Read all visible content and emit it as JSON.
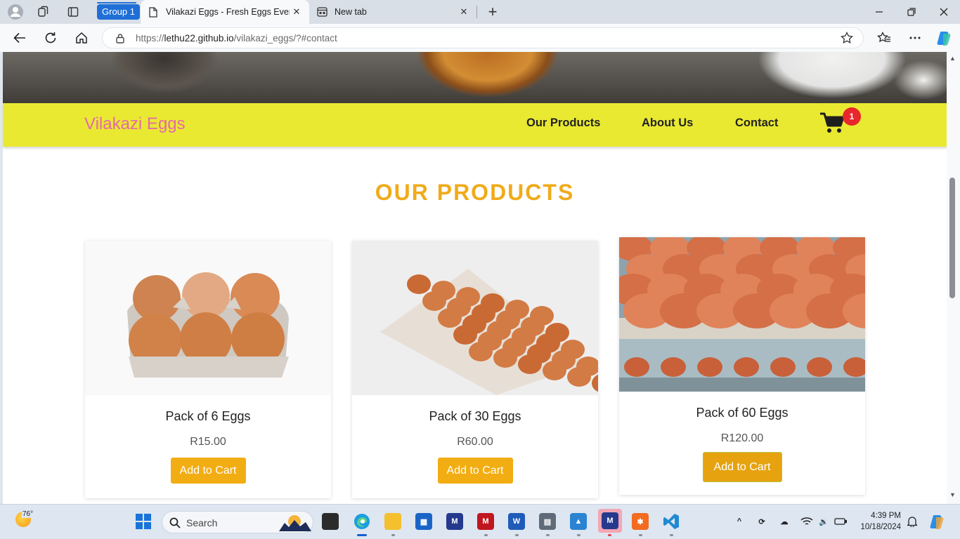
{
  "browser": {
    "group_label": "Group 1",
    "tabs": [
      {
        "title": "Vilakazi Eggs - Fresh Eggs Every D",
        "active": true
      },
      {
        "title": "New tab",
        "active": false
      }
    ],
    "url": {
      "prefix": "https://",
      "host": "lethu22.github.io",
      "path": "/vilakazi_eggs/?#contact"
    }
  },
  "site": {
    "brand": "Vilakazi Eggs",
    "nav": [
      "Our Products",
      "About Us",
      "Contact"
    ],
    "cart_count": "1",
    "section_title": "OUR PRODUCTS",
    "products": [
      {
        "name": "Pack of 6 Eggs",
        "price": "R15.00",
        "button": "Add to Cart"
      },
      {
        "name": "Pack of 30 Eggs",
        "price": "R60.00",
        "button": "Add to Cart"
      },
      {
        "name": "Pack of 60 Eggs",
        "price": "R120.00",
        "button": "Add to Cart"
      }
    ]
  },
  "taskbar": {
    "temperature": "76°",
    "search_placeholder": "Search",
    "time": "4:39 PM",
    "date": "10/18/2024"
  },
  "colors": {
    "nav_bg": "#e9e932",
    "brand_text": "#e66aa8",
    "section_title": "#f0ab1a",
    "button_bg": "#f2ad12",
    "badge": "#e8262b"
  }
}
